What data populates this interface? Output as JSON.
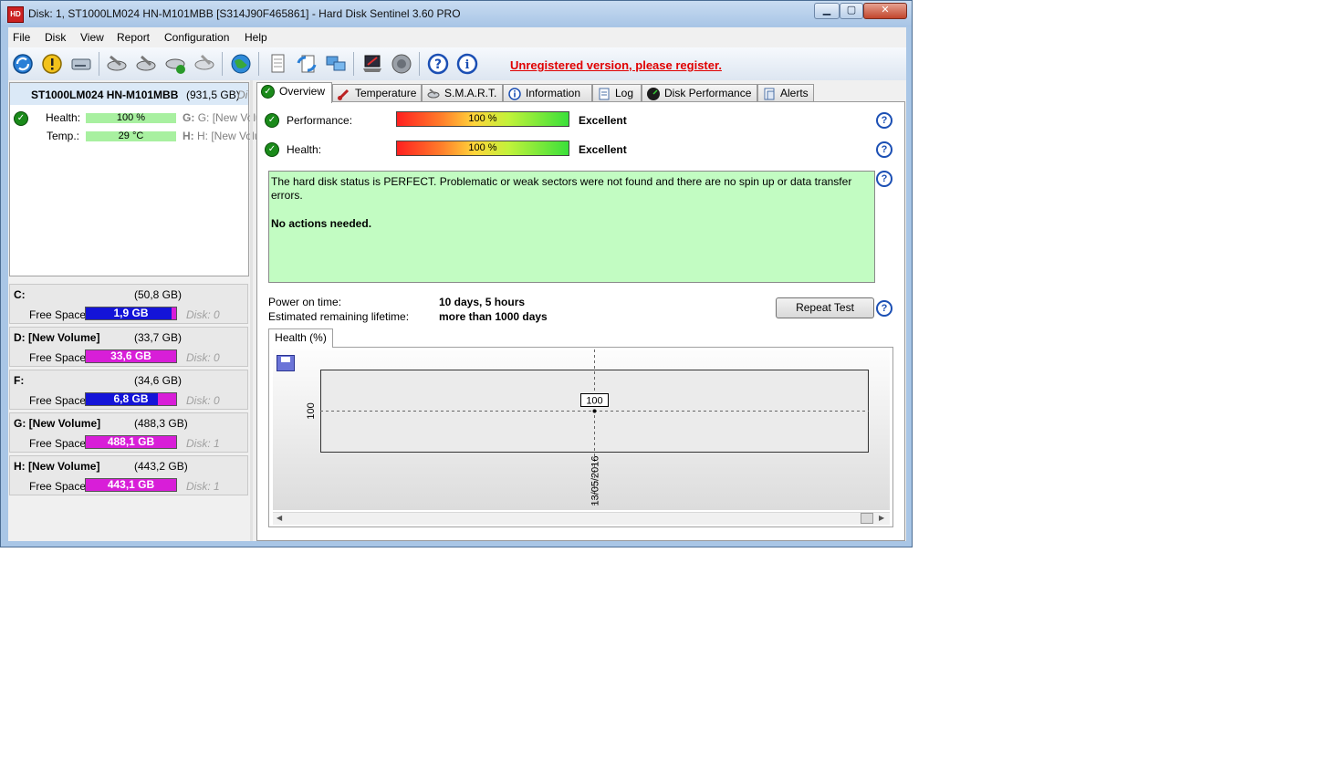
{
  "window": {
    "title": "Disk: 1, ST1000LM024 HN-M101MBB [S314J90F465861]  -  Hard Disk Sentinel 3.60 PRO",
    "minimize": "▁",
    "maximize": "▢",
    "close": "✕"
  },
  "menu": [
    "File",
    "Disk",
    "View",
    "Report",
    "Configuration",
    "Help"
  ],
  "toolbar": {
    "register_link": "Unregistered version, please register."
  },
  "disk": {
    "name": "ST1000LM024 HN-M101MBB",
    "size": "(931,5 GB)",
    "extra": "Di",
    "health_label": "Health:",
    "health_value": "100 %",
    "temp_label": "Temp.:",
    "temp_value": "29 °C",
    "vol_g": "G: [New Volu",
    "vol_h": "H: [New Volu"
  },
  "volumes": [
    {
      "name": "C:",
      "size": "(50,8 GB)",
      "free_label": "Free Space",
      "free": "1,9 GB",
      "disk": "Disk: 0",
      "color": "#1414d8",
      "used_color": "#d81ed8"
    },
    {
      "name": "D: [New Volume]",
      "size": "(33,7 GB)",
      "free_label": "Free Space",
      "free": "33,6 GB",
      "disk": "Disk: 0",
      "color": "#d81ed8",
      "used_color": "#d81ed8"
    },
    {
      "name": "F:",
      "size": "(34,6 GB)",
      "free_label": "Free Space",
      "free": "6,8 GB",
      "disk": "Disk: 0",
      "color": "#1414d8",
      "used_color": "#d81ed8"
    },
    {
      "name": "G: [New Volume]",
      "size": "(488,3 GB)",
      "free_label": "Free Space",
      "free": "488,1 GB",
      "disk": "Disk: 1",
      "color": "#d81ed8",
      "used_color": "#d81ed8"
    },
    {
      "name": "H: [New Volume]",
      "size": "(443,2 GB)",
      "free_label": "Free Space",
      "free": "443,1 GB",
      "disk": "Disk: 1",
      "color": "#d81ed8",
      "used_color": "#d81ed8"
    }
  ],
  "tabs": [
    "Overview",
    "Temperature",
    "S.M.A.R.T.",
    "Information",
    "Log",
    "Disk Performance",
    "Alerts"
  ],
  "overview": {
    "performance_label": "Performance:",
    "performance_value": "100 %",
    "performance_rating": "Excellent",
    "health_label": "Health:",
    "health_value": "100 %",
    "health_rating": "Excellent",
    "status_text": "The hard disk status is PERFECT. Problematic or weak sectors were not found and there are no spin up or data transfer errors.",
    "status_action": "No actions needed.",
    "power_on_label": "Power on time:",
    "power_on_value": "10 days, 5 hours",
    "lifetime_label": "Estimated remaining lifetime:",
    "lifetime_value": "more than 1000 days",
    "repeat_test": "Repeat Test"
  },
  "chart_tab": "Health (%)",
  "chart_data": {
    "type": "line",
    "x": [
      "13/05/2016"
    ],
    "series": [
      {
        "values": [
          100
        ]
      }
    ],
    "y_tick": "100",
    "point_label": "100",
    "x_tick": "13/05/2016"
  }
}
